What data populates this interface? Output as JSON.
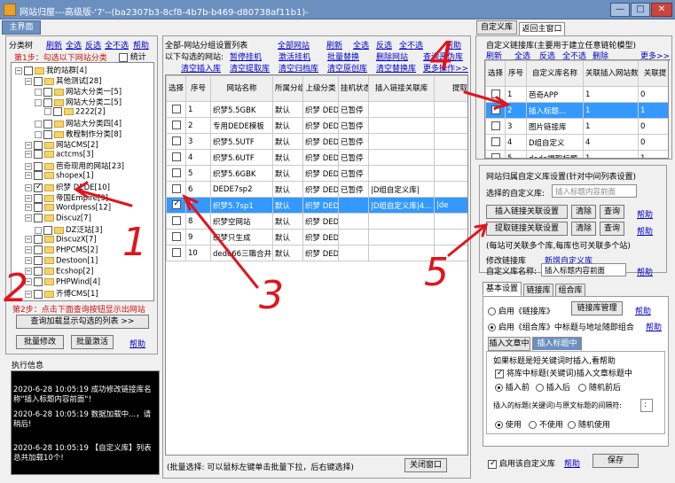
{
  "window": {
    "title": "网站归屋---高级版-'7'--(ba2307b3-8cf8-4b7b-b469-d80738af11b1)-",
    "min": "—",
    "max": "□",
    "close": "✕"
  },
  "tabs": {
    "main": "主界面",
    "custom_lib": "自定义库",
    "back": "返回主窗口"
  },
  "left": {
    "header": "分类树",
    "actions": [
      "刷新",
      "全选",
      "反选",
      "全不选",
      "帮助"
    ],
    "step1": "第1步：勾选以下网站分类",
    "stats_label": "统计",
    "tree": [
      {
        "label": "我的站群[4]"
      },
      {
        "label": "其他测试[28]"
      },
      {
        "label": "网站大分类一[5]"
      },
      {
        "label": "网站大分类二[5]"
      },
      {
        "label": "2222[2]"
      },
      {
        "label": "网站大分类四[4]"
      },
      {
        "label": "教程制作分类[8]"
      },
      {
        "label": "网站CMS[2]"
      },
      {
        "label": "actcms[3]"
      },
      {
        "label": "芭奇现用的网站[23]"
      },
      {
        "label": "shopex[1]"
      },
      {
        "label": "织梦 DEDE[10]"
      },
      {
        "label": "帝国Empire[3]"
      },
      {
        "label": "Wordpress[12]"
      },
      {
        "label": "Discuz[7]"
      },
      {
        "label": "DZ泛站[3]"
      },
      {
        "label": "DiscuzX[7]"
      },
      {
        "label": "PHPCMS[2]"
      },
      {
        "label": "Destoon[1]"
      },
      {
        "label": "Ecshop[2]"
      },
      {
        "label": "PHPWind[4]"
      },
      {
        "label": "齐博CMS[1]"
      }
    ],
    "step2": "第2步：点击下面查询按钮显示出网站",
    "query_btn": "查询加载显示勾选的列表 >>",
    "batch_edit": "批量修改",
    "batch_activate": "批量激活",
    "help": "帮助",
    "log_title": "执行信息",
    "log": [
      "2020-6-28 10:05:19  成功修改链接库名称\"插入标题内容前面\"！",
      "2020-6-28 10:05:19  数据加载中...，请稍后!",
      "2020-6-28 10:05:19  【自定义库】列表总共加载10个!"
    ]
  },
  "mid": {
    "title": "全部-网站分组设置列表",
    "all_sites": "全部网站",
    "actions_top": [
      "刷新",
      "全选",
      "反选",
      "全不选",
      "帮助"
    ],
    "checked_label": "以下勾选的网站:",
    "actions_r1": [
      "暂停挂机",
      "激活挂机",
      "批量替换",
      "删除网站",
      "查询恶伪库"
    ],
    "actions_r2": [
      "清空插入库",
      "清空提取库",
      "清空归档库",
      "清空原创库",
      "清空替换库",
      "更多操作>>"
    ],
    "columns": [
      "选择",
      "序号",
      "网站名称",
      "所属分组",
      "上级分类",
      "挂机状态",
      "插入链接关联库",
      "提取"
    ],
    "rows": [
      {
        "checked": false,
        "no": "1",
        "name": "织梦5.5GBK",
        "group": "默认",
        "parent": "织梦 DEDE",
        "status": "已暂停",
        "lib": "",
        "extract": ""
      },
      {
        "checked": false,
        "no": "2",
        "name": "专用DEDE模板",
        "group": "默认",
        "parent": "织梦 DEDE",
        "status": "已暂停",
        "lib": "",
        "extract": ""
      },
      {
        "checked": false,
        "no": "3",
        "name": "织梦5.5UTF",
        "group": "默认",
        "parent": "织梦 DEDE",
        "status": "已暂停",
        "lib": "",
        "extract": ""
      },
      {
        "checked": false,
        "no": "4",
        "name": "织梦5.6UTF",
        "group": "默认",
        "parent": "织梦 DEDE",
        "status": "已暂停",
        "lib": "",
        "extract": ""
      },
      {
        "checked": false,
        "no": "5",
        "name": "织梦5.6GBK",
        "group": "默认",
        "parent": "织梦 DEDE",
        "status": "已暂停",
        "lib": "",
        "extract": ""
      },
      {
        "checked": false,
        "no": "6",
        "name": "DEDE7sp2",
        "group": "默认",
        "parent": "织梦 DEDE",
        "status": "已暂停",
        "lib": "|D组自定义库|",
        "extract": ""
      },
      {
        "checked": true,
        "no": "7",
        "name": "织梦5.7sp1",
        "group": "默认",
        "parent": "织梦 DEDE",
        "status": "",
        "lib": "|D组自定义库|4...",
        "extract": "|de"
      },
      {
        "checked": false,
        "no": "8",
        "name": "织梦空网站",
        "group": "默认",
        "parent": "织梦 DEDE",
        "status": "",
        "lib": "",
        "extract": ""
      },
      {
        "checked": false,
        "no": "9",
        "name": "织梦只生成",
        "group": "默认",
        "parent": "织梦 DEDE",
        "status": "",
        "lib": "",
        "extract": ""
      },
      {
        "checked": false,
        "no": "10",
        "name": "dede66三職合并",
        "group": "默认",
        "parent": "织梦 DEDE",
        "status": "",
        "lib": "",
        "extract": ""
      }
    ],
    "footer_hint": "(批量选择: 可以鼠标左键单击批量下拉，后右键选择)",
    "close_btn": "关闭窗口"
  },
  "right": {
    "lib_title": "自定义链接库(主要用于建立任意链轮模型)",
    "actions": [
      "刷新",
      "全选",
      "反选",
      "全不选",
      "删除",
      "更多>>"
    ],
    "columns": [
      "选择",
      "序号",
      "自定义库名称",
      "关联插入网站数",
      "关联提"
    ],
    "rows": [
      {
        "checked": false,
        "no": "1",
        "name": "芭奇APP",
        "ins": "1",
        "ext": "0"
      },
      {
        "checked": true,
        "no": "2",
        "name": "插入标题...",
        "ins": "1",
        "ext": "1"
      },
      {
        "checked": false,
        "no": "3",
        "name": "图片链接库",
        "ins": "1",
        "ext": "0"
      },
      {
        "checked": false,
        "no": "4",
        "name": "D组自定义",
        "ins": "4",
        "ext": "0"
      },
      {
        "checked": false,
        "no": "5",
        "name": "dede提取标题",
        "ins": "1",
        "ext": "1"
      },
      {
        "checked": false,
        "no": "6",
        "name": "C组自定义",
        "ins": "3",
        "ext": "0"
      }
    ],
    "bind_title": "网站归属自定义库设置(针对中间列表设置)",
    "select_label": "选择的自定义库:",
    "select_placeholder": "插入标题内容前面",
    "ins_set_btn": "插入链接关联设置",
    "ext_set_btn": "提取链接关联设置",
    "clear": "清除",
    "query": "查询",
    "help": "帮助",
    "bind_note": "(每站可关联多个库,每库也可关联多个站)",
    "modify_label": "修改链接库",
    "new_label": "新增自定义库",
    "name_label": "自定义库名称:",
    "name_value": "插入标题内容前面",
    "name_help": "帮助",
    "tabs": [
      "基本设置",
      "链接库",
      "组合库"
    ],
    "enable_link": "启用《链接库》",
    "link_mgr_btn": "链接库管理",
    "link_help": "帮助",
    "enable_combo": "启用《组合库》中标题与地址随即组合",
    "combo_help": "帮助",
    "sub_tabs": [
      "插入文章中",
      "插入标题中"
    ],
    "short_kw_title": "如果标题是短关键词时插入,看帮助",
    "insert_kw": "将库中标题(关键词)插入文章标题中",
    "pos_before": "插入前",
    "pos_after": "插入后",
    "pos_random": "随机前后",
    "sep_label": "插入的标题(关键词)与原文标题的间隔符:",
    "sep_value": ":",
    "use": "使用",
    "not_use": "不使用",
    "random_use": "随机使用",
    "enable_lib": "启用该自定义库",
    "save_help": "帮助",
    "save": "保存"
  },
  "annotations": [
    "1",
    "2",
    "3",
    "4",
    "5"
  ]
}
